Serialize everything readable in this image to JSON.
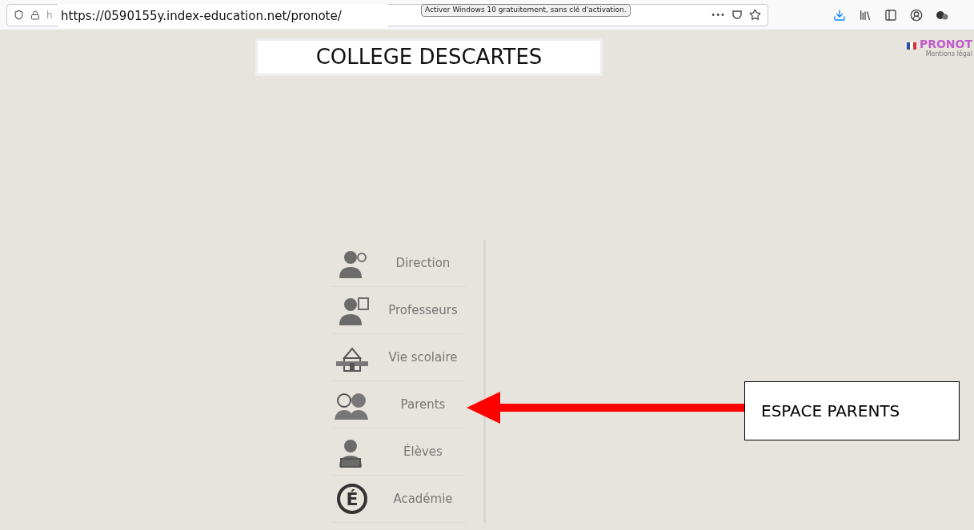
{
  "browser": {
    "url_stub": "h",
    "url_overlay": "https://0590155y.index-education.net/pronote/",
    "tooltip": "Activer Windows 10 gratuitement, sans clé d'activation.",
    "more": "•••"
  },
  "header": {
    "title": "COLLEGE DESCARTES",
    "logo": "PRONOT",
    "legal": "Mentions légal"
  },
  "menu": [
    {
      "label": "Direction",
      "kind": "admin",
      "selected": false
    },
    {
      "label": "Professeurs",
      "kind": "teacher",
      "selected": false
    },
    {
      "label": "Vie scolaire",
      "kind": "school",
      "selected": false
    },
    {
      "label": "Parents",
      "kind": "parents",
      "selected": false
    },
    {
      "label": "Élèves",
      "kind": "student",
      "selected": false
    },
    {
      "label": "Académie",
      "kind": "academy",
      "selected": false,
      "badge": "É"
    }
  ],
  "annotation": {
    "label": "ESPACE PARENTS"
  }
}
